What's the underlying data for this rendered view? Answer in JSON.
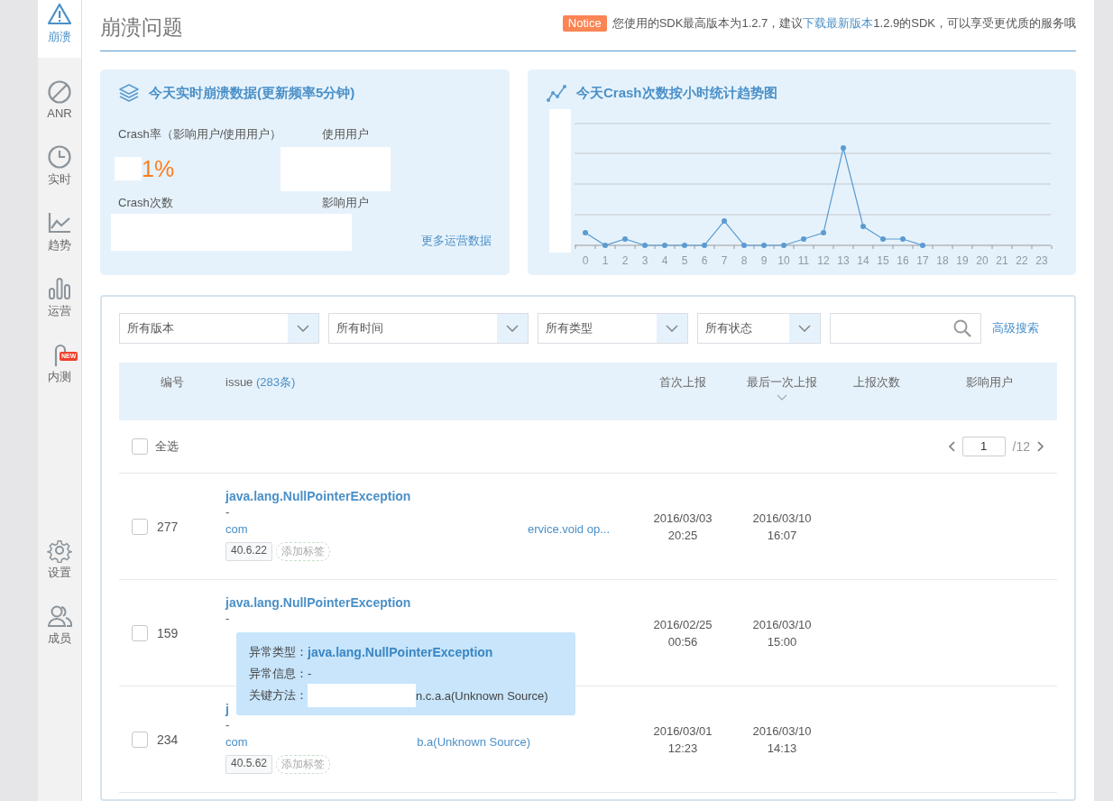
{
  "sidebar": {
    "items": [
      {
        "label": "崩溃",
        "kind": "warning",
        "selected": true
      },
      {
        "label": "ANR",
        "kind": "ban",
        "selected": false
      },
      {
        "label": "实时",
        "kind": "clock",
        "selected": false
      },
      {
        "label": "趋势",
        "kind": "trend",
        "selected": false
      },
      {
        "label": "运营",
        "kind": "bars",
        "selected": false
      },
      {
        "label": "内测",
        "kind": "beta",
        "selected": false,
        "badge": "NEW"
      }
    ],
    "bottom_items": [
      {
        "label": "设置",
        "kind": "gear",
        "selected": false
      },
      {
        "label": "成员",
        "kind": "users",
        "selected": false
      }
    ]
  },
  "header": {
    "title": "崩溃问题",
    "notice": {
      "badge": "Notice",
      "text_before": "您使用的SDK最高版本为1.2.7，建议",
      "link": "下载最新版本",
      "text_after": "1.2.9的SDK，可以享受更优质的服务哦"
    }
  },
  "realtime_card": {
    "title": "今天实时崩溃数据(更新频率5分钟)",
    "crash_rate_label": "Crash率（影响用户/使用用户）",
    "crash_rate_value": "1%",
    "users_label": "使用用户",
    "crash_count_label": "Crash次数",
    "affected_users_label": "影响用户",
    "more_link": "更多运营数据"
  },
  "trend_card": {
    "title": "今天Crash次数按小时统计趋势图",
    "x_labels": [
      "0",
      "1",
      "2",
      "3",
      "4",
      "5",
      "6",
      "7",
      "8",
      "9",
      "10",
      "11",
      "12",
      "13",
      "14",
      "15",
      "16",
      "17",
      "18",
      "19",
      "20",
      "21",
      "22",
      "23"
    ]
  },
  "filters": {
    "dropdowns": [
      "所有版本",
      "所有时间",
      "所有类型",
      "所有状态"
    ],
    "advanced_search": "高级搜索"
  },
  "table": {
    "columns": [
      {
        "label": "编号",
        "sorted": false
      },
      {
        "label": "issue",
        "count": "(283条)",
        "sorted": false
      },
      {
        "label": "首次上报",
        "sorted": false
      },
      {
        "label": "最后一次上报",
        "sorted": true
      },
      {
        "label": "上报次数",
        "sorted": false
      },
      {
        "label": "影响用户",
        "sorted": false
      }
    ],
    "select_all": {
      "label": "全选",
      "checked": false
    },
    "pagination": {
      "page": "1",
      "total": "/12"
    },
    "rows": [
      {
        "number": "277",
        "checked": false,
        "title": "java.lang.NullPointerException",
        "message": "-",
        "method_start": "com",
        "method_end": "ervice.void op...",
        "tags": [
          "40.6.22"
        ],
        "add_tag": "添加标签",
        "first_date": "2016/03/03",
        "first_time": "20:25",
        "last_date": "2016/03/10",
        "last_time": "16:07"
      },
      {
        "number": "159",
        "checked": false,
        "title": "java.lang.NullPointerException",
        "message": "-",
        "first_date": "2016/02/25",
        "first_time": "00:56",
        "last_date": "2016/03/10",
        "last_time": "15:00"
      },
      {
        "number": "234",
        "checked": false,
        "title": "j",
        "message": "-",
        "method_start": "com",
        "method_end": "b.a(Unknown Source)",
        "tags": [
          "40.5.62"
        ],
        "add_tag": "添加标签",
        "first_date": "2016/03/01",
        "first_time": "12:23",
        "last_date": "2016/03/10",
        "last_time": "14:13"
      }
    ]
  },
  "tooltip": {
    "type_label": "异常类型：",
    "type_value": "java.lang.NullPointerException",
    "info_label": "异常信息：-",
    "method_label": "关键方法：",
    "method_value": "n.c.a.a(Unknown Source)"
  }
}
